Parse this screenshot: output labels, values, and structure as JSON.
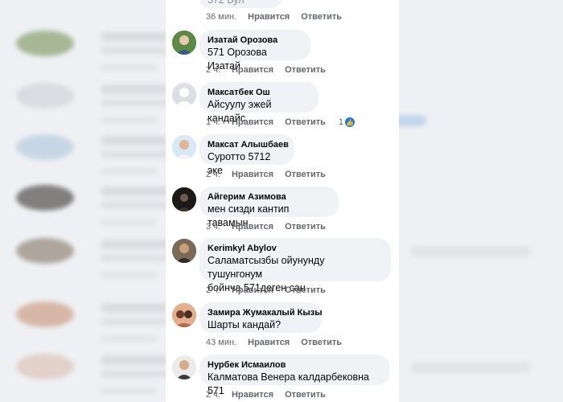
{
  "labels": {
    "like": "Нравится",
    "reply": "Ответить"
  },
  "top": {
    "time": "36 мин.",
    "partial_text": "572 Бул"
  },
  "comments": [
    {
      "author": "Изатай Орозова",
      "text": "571 Орозова Изатай",
      "time": "2 ч.",
      "avatar": "avatar-photo"
    },
    {
      "author": "Максатбек Ош",
      "text": "Айсуулу эжей кандайс",
      "time": "1 ч.",
      "avatar": "default-avatar-icon",
      "reactions": "1"
    },
    {
      "author": "Максат Алышбаев",
      "text": "Суротто 5712 эке",
      "time": "2 ч.",
      "avatar": "avatar-photo"
    },
    {
      "author": "Айгерим Азимова",
      "text": "мен сизди кантип тавамын",
      "time": "3 ч.",
      "avatar": "avatar-photo"
    },
    {
      "author": "Kerimkyl Abylov",
      "text_lines": [
        "Саламатсызбы ойунунду тушунгонум",
        "бойнча 571деген сан"
      ],
      "time": "2 ч.",
      "avatar": "avatar-photo"
    },
    {
      "author": "Замира Жумакалый Кызы",
      "text": "Шарты кандай?",
      "time": "43 мин.",
      "avatar": "avatar-photo"
    },
    {
      "author": "Нурбек Исмаилов",
      "text": "Калматова Венера калдарбековна 571",
      "time": "2 ч.",
      "avatar": "avatar-photo"
    }
  ],
  "colors": {
    "bubble": "#f0f2f5",
    "meta": "#65676b",
    "like": "#1877f2"
  }
}
